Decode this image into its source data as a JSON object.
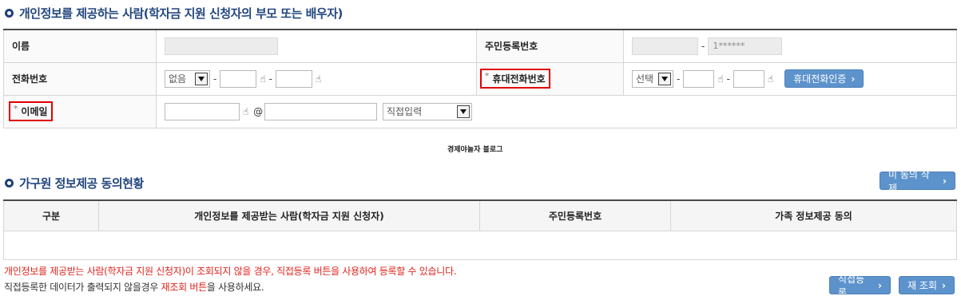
{
  "section1": {
    "title": "개인정보를 제공하는 사람(학자금 지원 신청자의 부모 또는 배우자)"
  },
  "form": {
    "name_label": "이름",
    "rrn_label": "주민등록번호",
    "rrn_back_value": "1******",
    "phone_label": "전화번호",
    "phone_area_value": "없음",
    "mobile_label": "휴대전화번호",
    "mobile_prefix_value": "선택",
    "mobile_verify_button": "휴대전화인증",
    "email_label": "이메일",
    "email_at": "@",
    "email_domain_value": "직접입력",
    "required_mark": "*",
    "dash": "-"
  },
  "watermark": "경제야놀자 블로그",
  "section2": {
    "title": "가구원 정보제공 동의현황",
    "delete_unconsented_button": "미 동의 삭제"
  },
  "list_table": {
    "columns": [
      "구분",
      "개인정보를 제공받는 사람(학자금 지원 신청자)",
      "주민등록번호",
      "가족 정보제공 동의"
    ]
  },
  "notes": {
    "line1": "개인정보를 제공받는 사람(학자금 지원 신청자)이 조회되지 않을 경우, 직접등록 버튼을 사용하여 등록할 수 있습니다.",
    "line2_pre": "직접등록한 데이터가 출력되지 않을경우 ",
    "line2_highlight": "재조회 버튼",
    "line2_post": "을 사용하세요."
  },
  "bottom_buttons": {
    "direct_register": "직접등록",
    "re_query": "재 조회"
  },
  "icons": {
    "chevron": "›",
    "input_hand": "☝"
  },
  "colors": {
    "accent": "#24477f",
    "button": "#5d93cc",
    "alert": "#e0241c",
    "highlight_box": "#e00000"
  }
}
